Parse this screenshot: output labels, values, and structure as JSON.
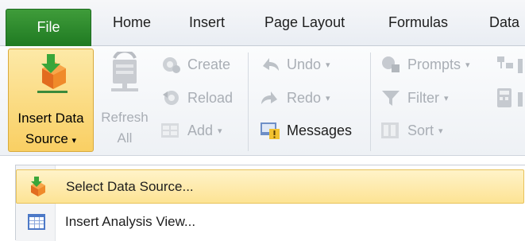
{
  "tabs": {
    "file": "File",
    "home": "Home",
    "insert": "Insert",
    "page_layout": "Page Layout",
    "formulas": "Formulas",
    "data": "Data"
  },
  "ribbon": {
    "insert_data_source": {
      "line1": "Insert Data",
      "line2": "Source",
      "arrow": "▾"
    },
    "refresh_all": {
      "line1": "Refresh",
      "line2": "All"
    },
    "create": "Create",
    "reload": "Reload",
    "add": "Add",
    "undo": "Undo",
    "redo": "Redo",
    "messages": "Messages",
    "prompts": "Prompts",
    "filter": "Filter",
    "sort": "Sort",
    "dropdown_arrow": "▾"
  },
  "menu": {
    "items": [
      {
        "label": "Select Data Source...",
        "icon": "insert-data-source-icon",
        "highlighted": true
      },
      {
        "label": "Insert Analysis View...",
        "icon": "analysis-view-icon",
        "highlighted": false
      }
    ]
  },
  "colors": {
    "file_tab": "#2e8b2e",
    "selected_button": "#f9cf63",
    "menu_highlight": "#fde394"
  }
}
